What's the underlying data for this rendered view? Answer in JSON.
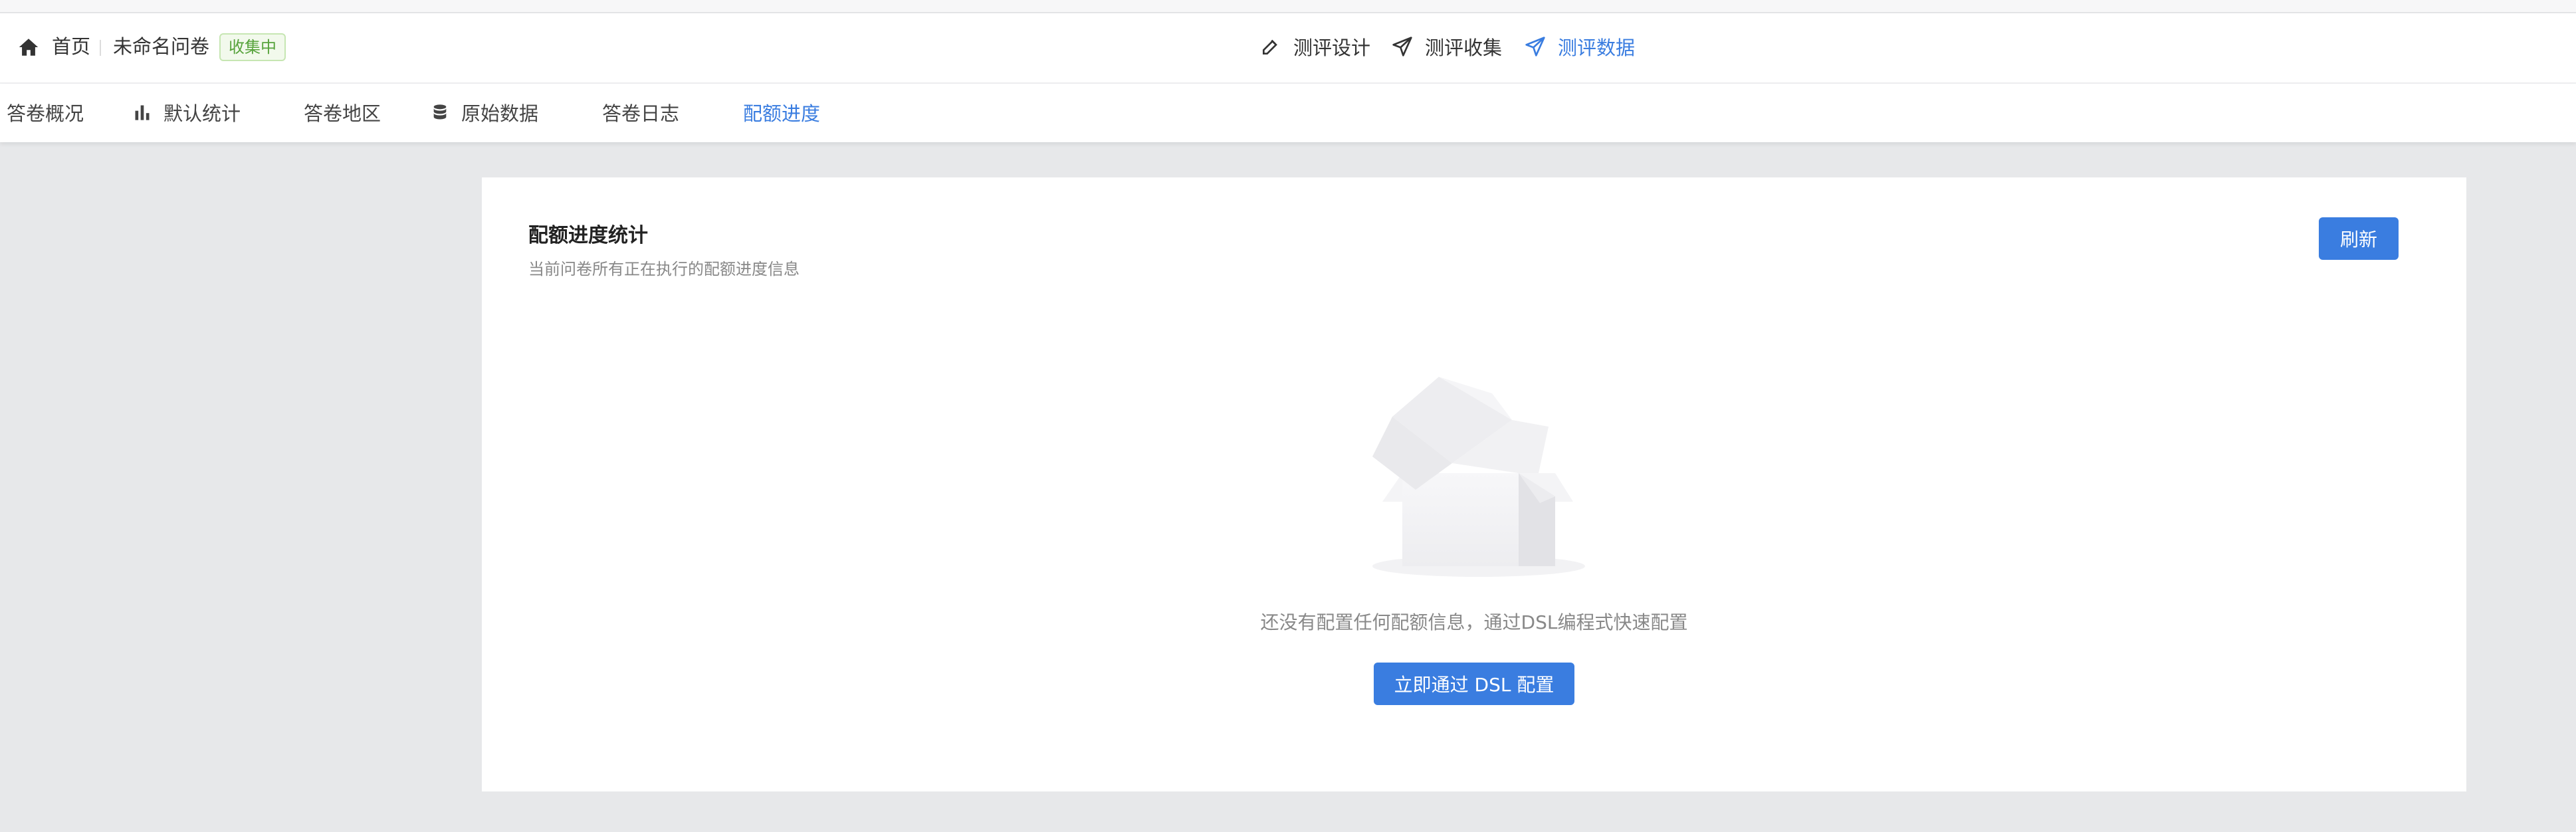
{
  "header": {
    "home_label": "首页",
    "survey_name": "未命名问卷",
    "status_badge": "收集中",
    "modes": [
      {
        "label": "测评设计",
        "icon": "edit-icon"
      },
      {
        "label": "测评收集",
        "icon": "send-icon"
      },
      {
        "label": "测评数据",
        "icon": "send-icon",
        "active": true
      }
    ]
  },
  "subnav": {
    "tabs": [
      {
        "label": "答卷概况",
        "icon": null
      },
      {
        "label": "默认统计",
        "icon": "bar-chart-icon"
      },
      {
        "label": "答卷地区",
        "icon": null
      },
      {
        "label": "原始数据",
        "icon": "database-icon"
      },
      {
        "label": "答卷日志",
        "icon": null
      },
      {
        "label": "配额进度",
        "icon": null,
        "active": true
      }
    ]
  },
  "card": {
    "title": "配额进度统计",
    "subtitle": "当前问卷所有正在执行的配额进度信息",
    "refresh_label": "刷新",
    "empty_text": "还没有配置任何配额信息，通过DSL编程式快速配置",
    "dsl_button_label": "立即通过 DSL 配置",
    "empty_icon": "empty-box-icon"
  },
  "colors": {
    "accent": "#3a7de0",
    "status_badge_text": "#57a33c",
    "background": "#e7e8ea"
  }
}
